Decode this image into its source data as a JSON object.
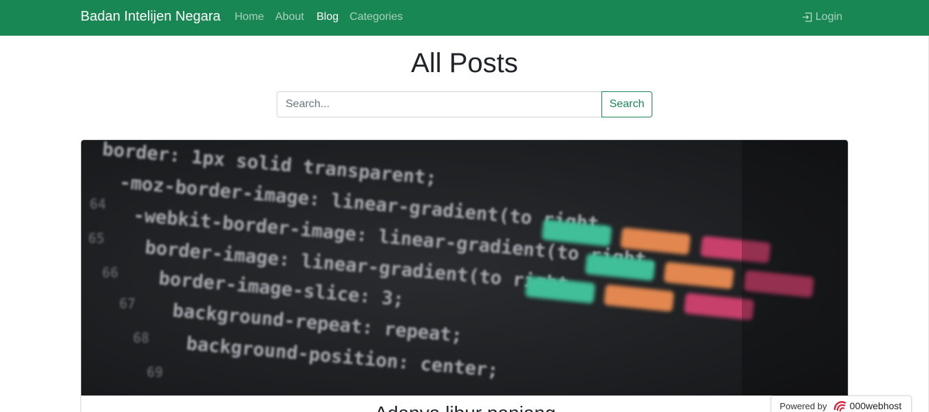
{
  "nav": {
    "brand": "Badan Intelijen Negara",
    "links": [
      {
        "label": "Home"
      },
      {
        "label": "About"
      },
      {
        "label": "Blog"
      },
      {
        "label": "Categories"
      }
    ],
    "login_label": "Login"
  },
  "page": {
    "title": "All Posts"
  },
  "search": {
    "placeholder": "Search...",
    "value": "",
    "button_label": "Search"
  },
  "post": {
    "image_code_lines": [
      "border: 1px solid transparent;",
      "-moz-border-image: linear-gradient(to right,",
      "-webkit-border-image: linear-gradient(to right,",
      "border-image: linear-gradient(to right,",
      "border-image-slice: 3;",
      "background-repeat: repeat;",
      "background-position: center;"
    ],
    "title": "Adanya libur panjang"
  },
  "footer_badge": {
    "powered_by": "Powered by",
    "brand": "000webhost"
  },
  "colors": {
    "navbar": "#198754",
    "accent": "#198754"
  }
}
